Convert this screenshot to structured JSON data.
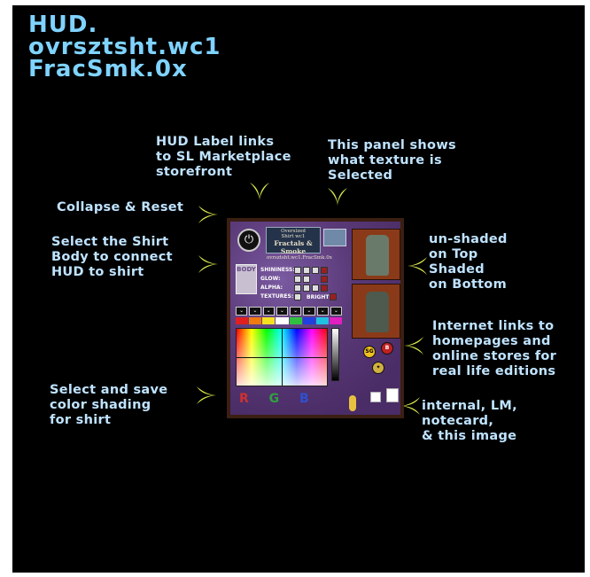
{
  "title_lines": [
    "HUD.",
    "ovrsztsht.wc1",
    "FracSmk.0x"
  ],
  "callouts": {
    "hud_label": [
      "HUD Label links",
      "to SL Marketplace",
      "storefront"
    ],
    "panel": [
      "This panel shows",
      "what texture is",
      "Selected"
    ],
    "collapse": [
      "Collapse & Reset"
    ],
    "select_shirt": [
      "Select the Shirt",
      "Body to connect",
      "HUD to shirt"
    ],
    "shading": [
      "un-shaded",
      "on Top",
      "Shaded",
      "on Bottom"
    ],
    "internet": [
      "Internet links to",
      "homepages and",
      "online stores for",
      "real life editions"
    ],
    "color": [
      "Select and save",
      "color shading",
      "for shirt"
    ],
    "internal": [
      "internal, LM,",
      "notecard,",
      "& this image"
    ]
  },
  "hud": {
    "label_lines": [
      "Overslzed",
      "Shirt wc1",
      "Fractals & Smoke",
      "ovrsztsht.wc1.FracSmk.0x"
    ],
    "body_label": "BODY",
    "prop_labels": [
      "SHININESS:",
      "GLOW:",
      "ALPHA:",
      "TEXTURES:"
    ],
    "bright_label": "BRIGHT:",
    "shininess_opts": [
      "L",
      "M",
      "H"
    ],
    "rgb": [
      "R",
      "G",
      "B"
    ],
    "swatch_colors": [
      "#e02020",
      "#f07a10",
      "#f4e020",
      "#ffffff",
      "#30c040",
      "#2040e0",
      "#20c0e0",
      "#e020c0"
    ],
    "link_icons": [
      "SG",
      "B"
    ]
  },
  "colors": {
    "title": "#7fd3ff",
    "callout": "#bfe3ff",
    "arrow": "#d9e84a"
  }
}
